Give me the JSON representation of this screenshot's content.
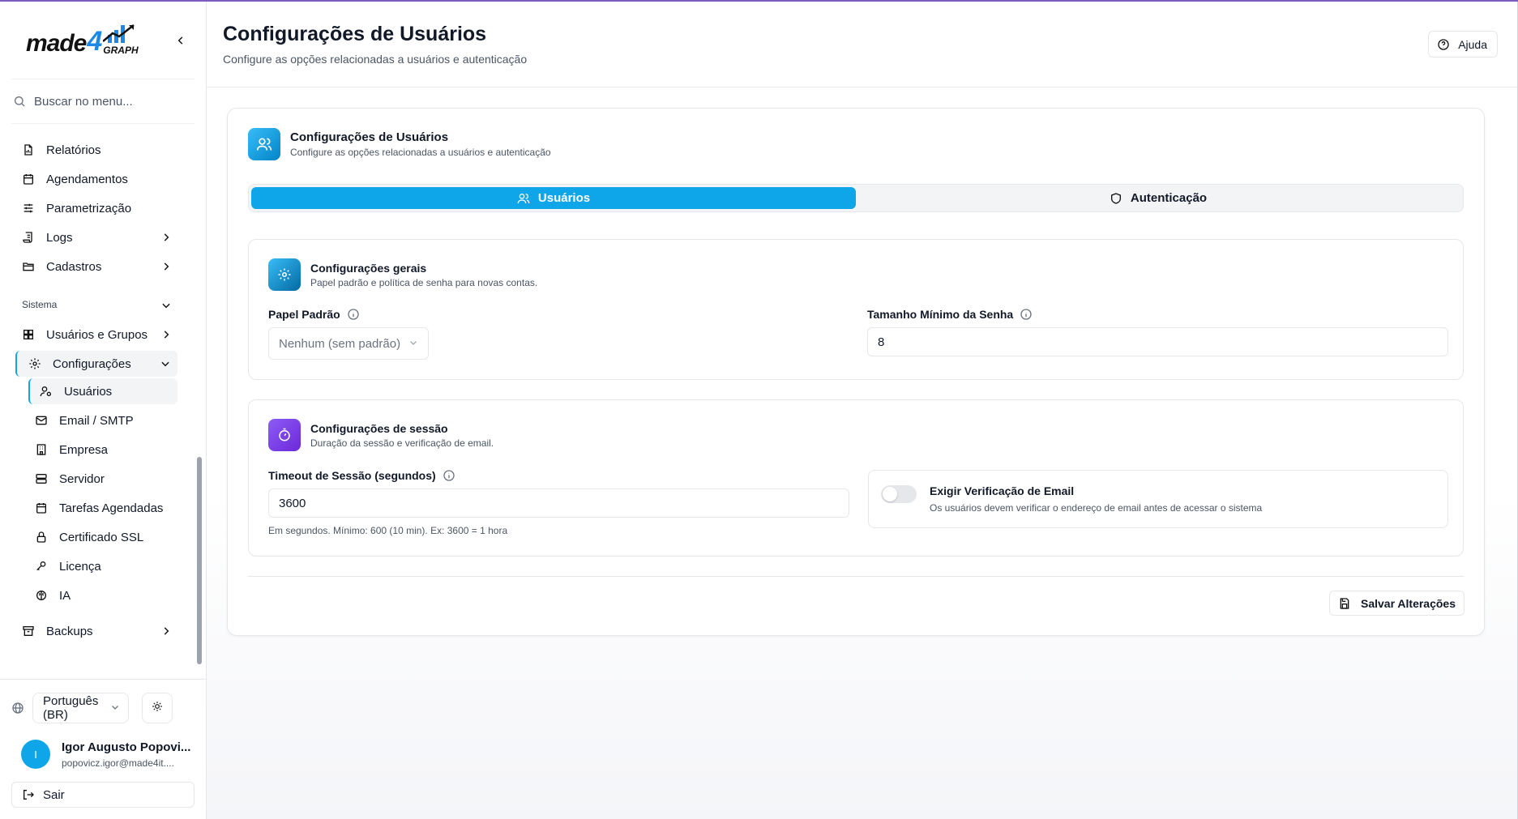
{
  "brand": {
    "logo_made": "made",
    "logo_4": "4",
    "logo_graph": "GRAPH"
  },
  "sidebar": {
    "search_placeholder": "Buscar no menu...",
    "items": [
      {
        "label": "Relatórios",
        "icon": "file-chart-icon"
      },
      {
        "label": "Agendamentos",
        "icon": "calendar-icon"
      },
      {
        "label": "Parametrização",
        "icon": "sliders-icon"
      },
      {
        "label": "Logs",
        "icon": "scroll-icon"
      },
      {
        "label": "Cadastros",
        "icon": "folder-icon"
      }
    ],
    "section_label": "Sistema",
    "users_groups": "Usuários e Grupos",
    "configuracoes": "Configurações",
    "sub_items": [
      {
        "label": "Usuários",
        "icon": "user-cog-icon",
        "active": true
      },
      {
        "label": "Email / SMTP",
        "icon": "mail-icon"
      },
      {
        "label": "Empresa",
        "icon": "building-icon"
      },
      {
        "label": "Servidor",
        "icon": "server-icon"
      },
      {
        "label": "Tarefas Agendadas",
        "icon": "calendar-icon"
      },
      {
        "label": "Certificado SSL",
        "icon": "lock-icon"
      },
      {
        "label": "Licença",
        "icon": "key-icon"
      },
      {
        "label": "IA",
        "icon": "brain-icon"
      }
    ],
    "backups": "Backups",
    "language": "Português (BR)",
    "user_initial": "I",
    "user_name": "Igor Augusto Popovi...",
    "user_email": "popovicz.igor@made4it....",
    "logout": "Sair"
  },
  "header": {
    "title": "Configurações de Usuários",
    "subtitle": "Configure as opções relacionadas a usuários e autenticação",
    "help": "Ajuda"
  },
  "card": {
    "title": "Configurações de Usuários",
    "subtitle": "Configure as opções relacionadas a usuários e autenticação",
    "tabs": [
      {
        "label": "Usuários",
        "active": true
      },
      {
        "label": "Autenticação",
        "active": false
      }
    ]
  },
  "general": {
    "title": "Configurações gerais",
    "subtitle": "Papel padrão e política de senha para novas contas.",
    "role_label": "Papel Padrão",
    "role_value": "Nenhum (sem padrão)",
    "min_pw_label": "Tamanho Mínimo da Senha",
    "min_pw_value": "8"
  },
  "session": {
    "title": "Configurações de sessão",
    "subtitle": "Duração da sessão e verificação de email.",
    "timeout_label": "Timeout de Sessão (segundos)",
    "timeout_value": "3600",
    "timeout_hint": "Em segundos. Mínimo: 600 (10 min). Ex: 3600 = 1 hora",
    "verify_title": "Exigir Verificação de Email",
    "verify_sub": "Os usuários devem verificar o endereço de email antes de acessar o sistema",
    "verify_enabled": false
  },
  "save_button": "Salvar Alterações",
  "colors": {
    "accent": "#0ea5e9",
    "purple": "#7c3aed"
  }
}
